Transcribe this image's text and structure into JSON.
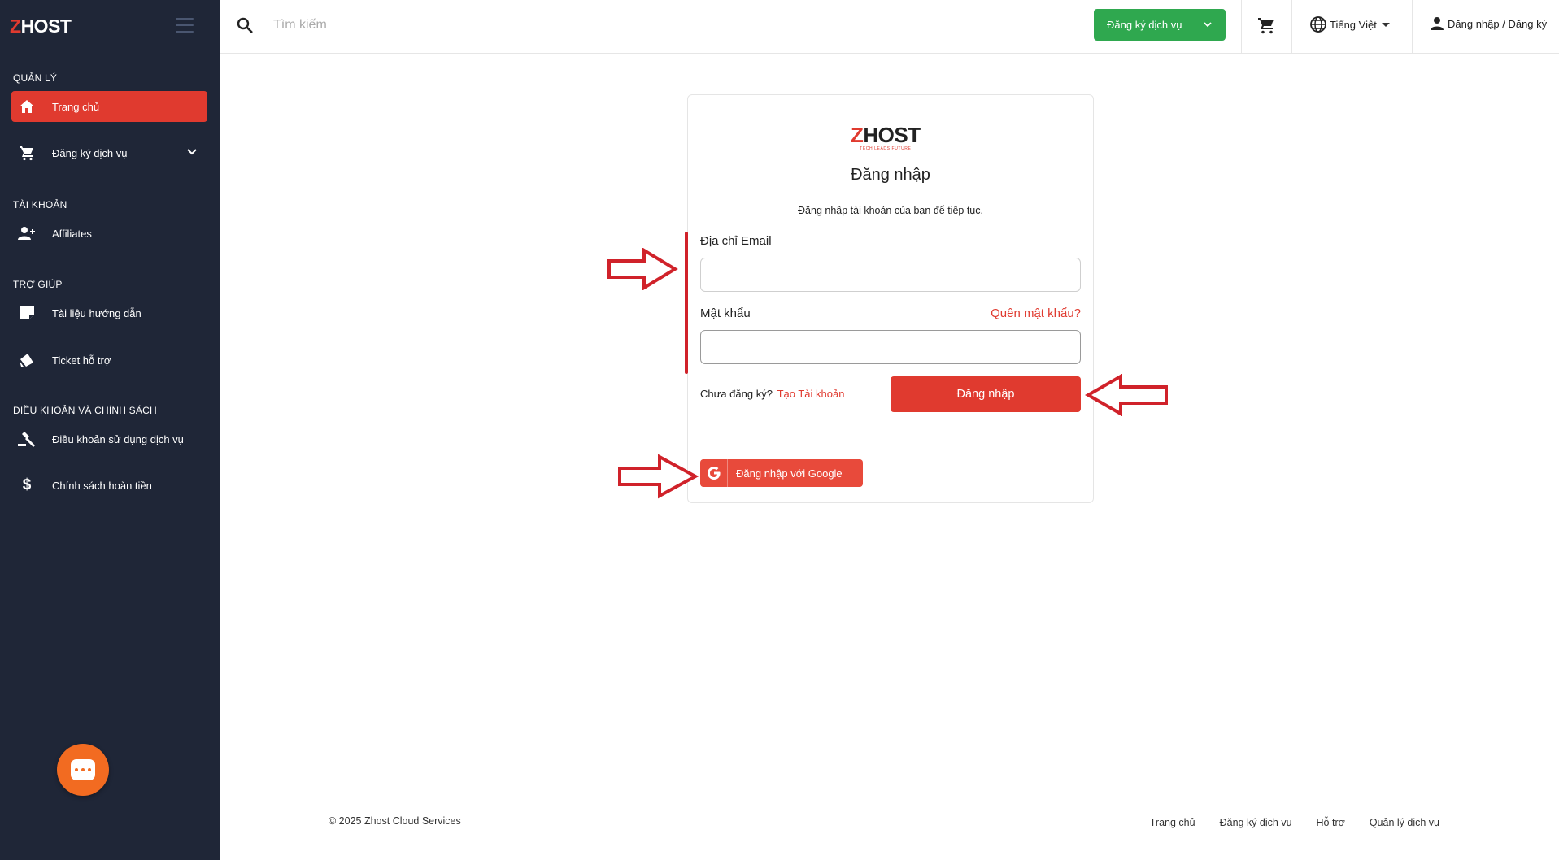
{
  "brand": {
    "name_z": "Z",
    "name_rest": "HOST",
    "tagline": "TECH LEADS FUTURE",
    "accent": "#e03a2f",
    "sidebar_bg": "#1f2637",
    "success": "#2fa84f"
  },
  "sidebar": {
    "sections": [
      {
        "title": "QUẢN LÝ",
        "items": [
          {
            "label": "Trang chủ",
            "icon": "home-icon",
            "active": true
          },
          {
            "label": "Đăng ký dịch vụ",
            "icon": "cart-icon",
            "expandable": true
          }
        ]
      },
      {
        "title": "TÀI KHOẢN",
        "items": [
          {
            "label": "Affiliates",
            "icon": "add-user-icon"
          }
        ]
      },
      {
        "title": "TRỢ GIÚP",
        "items": [
          {
            "label": "Tài liệu hướng dẫn",
            "icon": "note-icon"
          },
          {
            "label": "Ticket hỗ trợ",
            "icon": "ticket-icon"
          }
        ]
      },
      {
        "title": "ĐIỀU KHOẢN VÀ CHÍNH SÁCH",
        "items": [
          {
            "label": "Điều khoản sử dụng dịch vụ",
            "icon": "gavel-icon"
          },
          {
            "label": "Chính sách hoàn tiền",
            "icon": "dollar-icon"
          }
        ]
      }
    ]
  },
  "topbar": {
    "search_placeholder": "Tìm kiếm",
    "register_button": "Đăng ký dịch vụ",
    "language": "Tiếng Việt",
    "login_link": "Đăng nhập / Đăng ký"
  },
  "login": {
    "title": "Đăng nhập",
    "subtitle": "Đăng nhập tài khoản của bạn để tiếp tục.",
    "email_label": "Địa chỉ Email",
    "email_value": "",
    "password_label": "Mật khẩu",
    "password_value": "",
    "forgot": "Quên mật khẩu?",
    "no_account": "Chưa đăng ký?",
    "create_account": "Tạo Tài khoản",
    "submit": "Đăng nhập",
    "google": "Đăng nhập với Google"
  },
  "footer": {
    "copyright": "© 2025 Zhost Cloud Services",
    "links": [
      "Trang chủ",
      "Đăng ký dịch vụ",
      "Hỗ trợ",
      "Quản lý dịch vụ"
    ]
  }
}
